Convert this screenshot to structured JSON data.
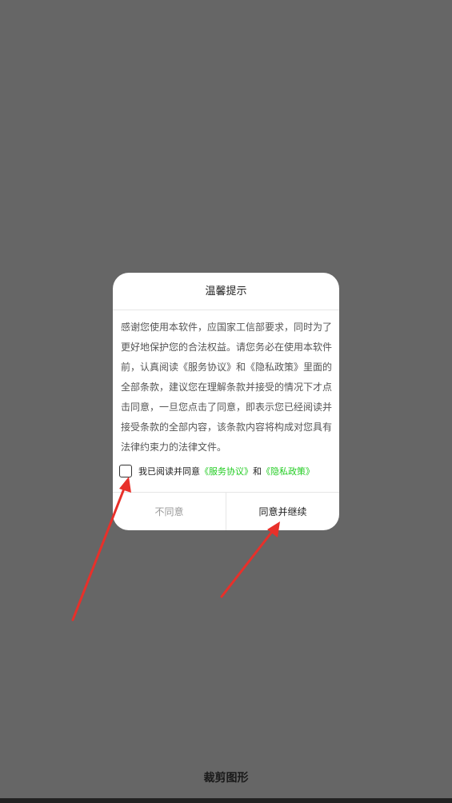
{
  "dialog": {
    "title": "温馨提示",
    "body": "感谢您使用本软件，应国家工信部要求，同时为了更好地保护您的合法权益。请您务必在使用本软件前，认真阅读《服务协议》和《隐私政策》里面的全部条款，建议您在理解条款并接受的情况下才点击同意，一旦您点击了同意，即表示您已经阅读并接受条款的全部内容，该条款内容将构成对您具有法律约束力的法律文件。",
    "agree_prefix": "我已阅读并同意",
    "service_link": "《服务协议》",
    "and": "和",
    "privacy_link": "《隐私政策》",
    "decline_label": "不同意",
    "accept_label": "同意并继续"
  },
  "footer": {
    "crop_label": "裁剪图形"
  },
  "colors": {
    "overlay": "#666666",
    "link": "#22cc22",
    "arrow": "#e8302a"
  }
}
